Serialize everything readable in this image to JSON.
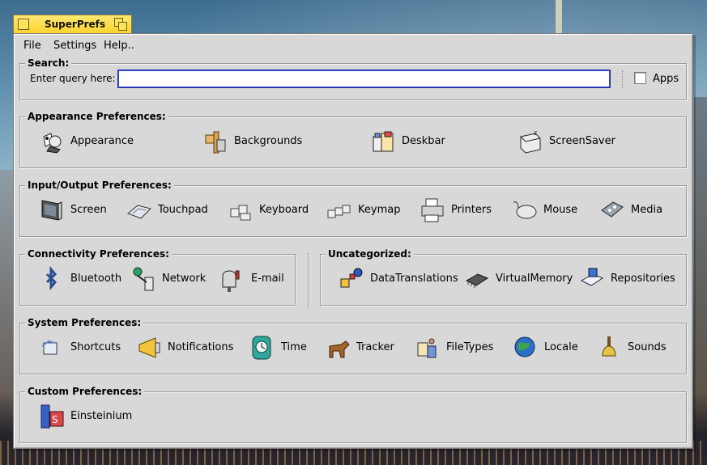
{
  "window": {
    "title": "SuperPrefs"
  },
  "menu": [
    "File",
    "Settings",
    "Help.."
  ],
  "search": {
    "group_label": "Search:",
    "query_label": "Enter query here:",
    "query_value": "",
    "apps_label": "Apps",
    "apps_checked": false
  },
  "groups": {
    "appearance": {
      "label": "Appearance Preferences:",
      "items": [
        "Appearance",
        "Backgrounds",
        "Deskbar",
        "ScreenSaver"
      ]
    },
    "io": {
      "label": "Input/Output Preferences:",
      "items": [
        "Screen",
        "Touchpad",
        "Keyboard",
        "Keymap",
        "Printers",
        "Mouse",
        "Media"
      ]
    },
    "connectivity": {
      "label": "Connectivity Preferences:",
      "items": [
        "Bluetooth",
        "Network",
        "E-mail"
      ]
    },
    "uncategorized": {
      "label": "Uncategorized:",
      "items": [
        "DataTranslations",
        "VirtualMemory",
        "Repositories"
      ]
    },
    "system": {
      "label": "System Preferences:",
      "items": [
        "Shortcuts",
        "Notifications",
        "Time",
        "Tracker",
        "FileTypes",
        "Locale",
        "Sounds"
      ]
    },
    "custom": {
      "label": "Custom Preferences:",
      "items": [
        "Einsteinium"
      ]
    }
  },
  "colors": {
    "tab": "#fcd22c",
    "window": "#d8d8d8",
    "focus": "#1e2ba8"
  }
}
